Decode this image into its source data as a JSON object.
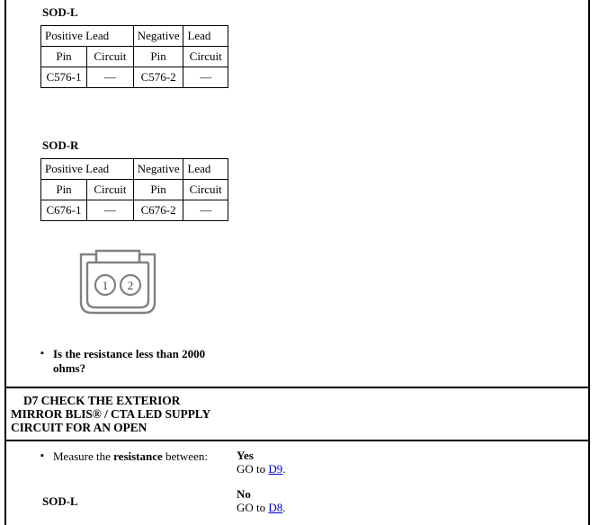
{
  "document": {
    "type": "vehicle-diagnostic-pinpoint-test"
  },
  "section_d6": {
    "left": {
      "group_1": {
        "label": "SOD-L",
        "table": {
          "header_spanned": [
            "Positive Lead",
            "Negative",
            "Lead"
          ],
          "subheaders": [
            "Pin",
            "Circuit",
            "Pin",
            "Circuit"
          ],
          "rows": [
            [
              "C576-1",
              "—",
              "C576-2",
              "—"
            ]
          ]
        }
      },
      "group_2": {
        "label": "SOD-R",
        "table": {
          "header_spanned": [
            "Positive Lead",
            "Negative",
            "Lead"
          ],
          "subheaders": [
            "Pin",
            "Circuit",
            "Pin",
            "Circuit"
          ],
          "rows": [
            [
              "C676-1",
              "—",
              "C676-2",
              "—"
            ]
          ]
        }
      },
      "connector": {
        "name": "two-pin-connector-face-view",
        "pins": [
          "1",
          "2"
        ],
        "stroke_color": "#808080"
      },
      "question": "Is the resistance less than 2000 ohms?"
    }
  },
  "section_d7": {
    "title_line_1": "D7 CHECK THE EXTERIOR MIRROR",
    "title_line_2": "BLIS® / CTA LED SUPPLY CIRCUIT FOR",
    "title_line_3": "AN OPEN",
    "instruction_prefix": "Measure the ",
    "instruction_bold": "resistance",
    "instruction_suffix": " between:",
    "sublabel": "SOD-L",
    "results": {
      "yes_label": "Yes",
      "yes_text_prefix": "GO to ",
      "yes_link": "D9",
      "yes_text_suffix": ".",
      "no_label": "No",
      "no_text_prefix": "GO to ",
      "no_link": "D8",
      "no_text_suffix": "."
    }
  },
  "colors": {
    "link": "#0000cc",
    "border": "#000000",
    "connector_line": "#808080",
    "page_background": "#ffffff"
  }
}
